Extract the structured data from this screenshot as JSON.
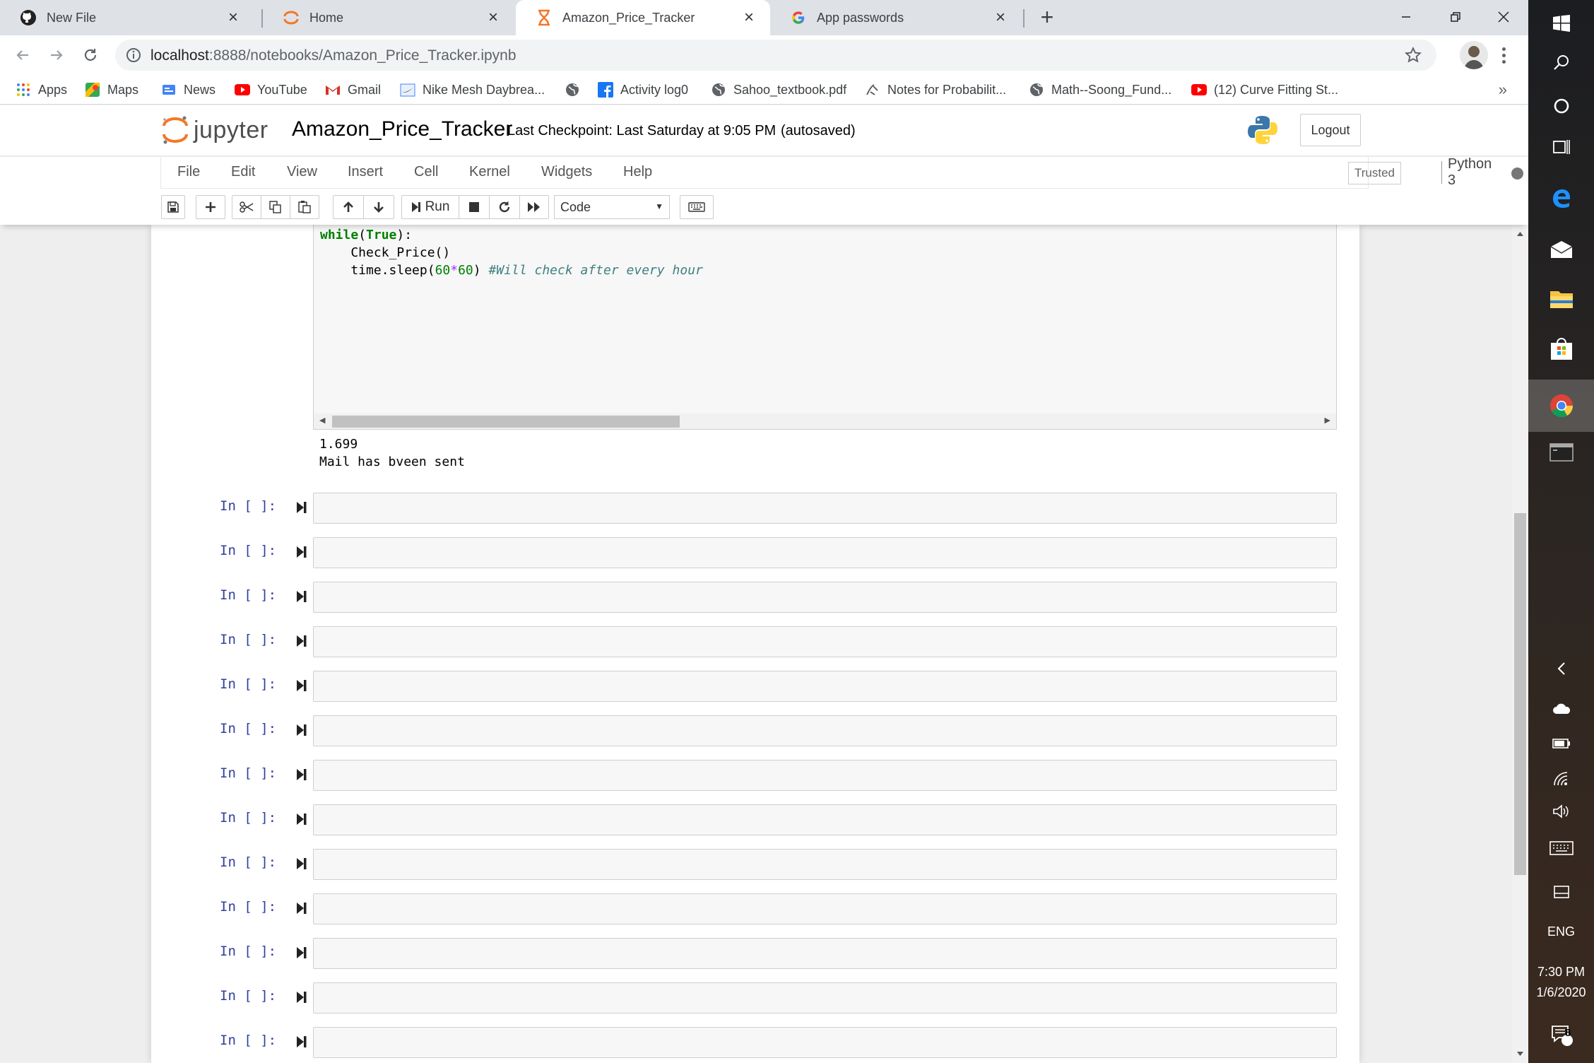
{
  "browser": {
    "tabs": [
      {
        "title": "New File",
        "icon": "github-icon",
        "active": false
      },
      {
        "title": "Home",
        "icon": "jupyter-icon",
        "active": false
      },
      {
        "title": "Amazon_Price_Tracker",
        "icon": "hourglass-icon",
        "active": true
      },
      {
        "title": "App passwords",
        "icon": "google-icon",
        "active": false
      }
    ],
    "url_host": "localhost",
    "url_path": ":8888/notebooks/Amazon_Price_Tracker.ipynb",
    "bookmarks": [
      {
        "label": "Apps",
        "icon": "apps-grid-icon"
      },
      {
        "label": "Maps",
        "icon": "maps-icon"
      },
      {
        "label": "News",
        "icon": "news-icon"
      },
      {
        "label": "YouTube",
        "icon": "youtube-icon"
      },
      {
        "label": "Gmail",
        "icon": "gmail-icon"
      },
      {
        "label": "Nike Mesh Daybrea...",
        "icon": "nike-icon"
      },
      {
        "label": "",
        "icon": "globe-icon"
      },
      {
        "label": "Activity log0",
        "icon": "facebook-icon"
      },
      {
        "label": "Sahoo_textbook.pdf",
        "icon": "globe-icon"
      },
      {
        "label": "Notes for Probabilit...",
        "icon": "page-icon"
      },
      {
        "label": "Math--Soong_Fund...",
        "icon": "globe-icon"
      },
      {
        "label": "(12) Curve Fitting St...",
        "icon": "youtube-icon"
      }
    ],
    "bookmarks_more": "»"
  },
  "jupyter": {
    "logo_text": "jupyter",
    "notebook_name": "Amazon_Price_Tracker",
    "checkpoint": "Last Checkpoint: Last Saturday at 9:05 PM",
    "autosave": "(autosaved)",
    "logout_label": "Logout",
    "menu": [
      "File",
      "Edit",
      "View",
      "Insert",
      "Cell",
      "Kernel",
      "Widgets",
      "Help"
    ],
    "trusted_label": "Trusted",
    "kernel_name": "Python 3",
    "run_label": "Run",
    "cell_type": "Code"
  },
  "notebook": {
    "code_lines": {
      "line1_kw": "while",
      "line1_rest_open": "(",
      "line1_true": "True",
      "line1_rest_close": "):",
      "line2": "    Check_Price()",
      "line3_pre": "    time.sleep(",
      "line3_n1": "60",
      "line3_op": "*",
      "line3_n2": "60",
      "line3_close": ") ",
      "line3_comment": "#Will check after every hour"
    },
    "output_lines": [
      "1.699",
      "Mail has bveen sent"
    ],
    "empty_prompt": "In [ ]:",
    "empty_cell_count": 13
  },
  "taskbar": {
    "language": "ENG",
    "time": "7:30 PM",
    "date": "1/6/2020",
    "notification_count": "8"
  },
  "colors": {
    "jupyter_orange": "#f37726",
    "prompt_blue": "#303f9f",
    "keyword_green": "#008000",
    "comment_teal": "#408080"
  }
}
